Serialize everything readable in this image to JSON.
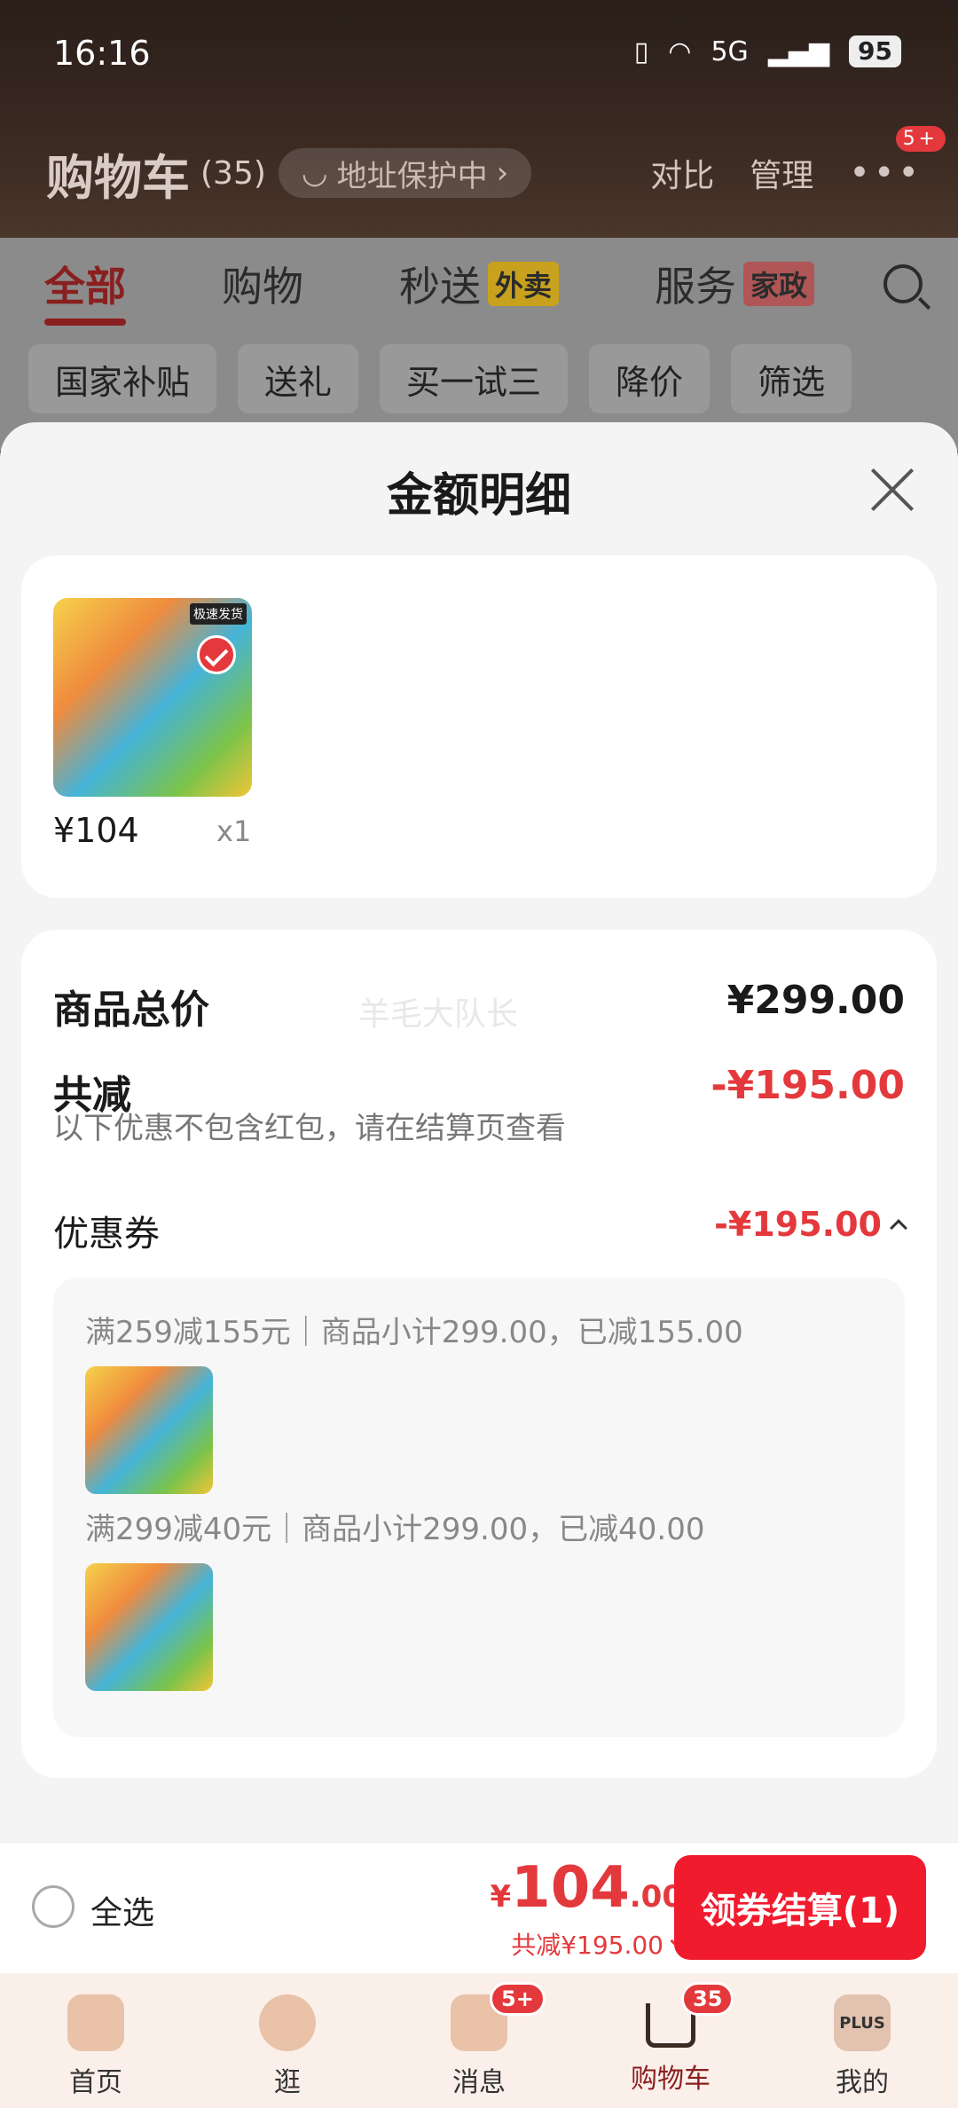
{
  "status_bar": {
    "time": "16:16",
    "network": "5G",
    "battery": "95"
  },
  "header": {
    "title": "购物车",
    "count": "(35)",
    "address": "地址保护中",
    "compare": "对比",
    "manage": "管理",
    "more_badge": "5+"
  },
  "tabs": [
    {
      "label": "全部",
      "tag": ""
    },
    {
      "label": "购物",
      "tag": ""
    },
    {
      "label": "秒送",
      "tag": "外卖"
    },
    {
      "label": "服务",
      "tag": "家政"
    }
  ],
  "chips": [
    "国家补贴",
    "送礼",
    "买一试三",
    "降价",
    "筛选"
  ],
  "sheet": {
    "title": "金额明细",
    "product": {
      "price": "¥104",
      "qty": "x1",
      "image_tag": "极速发货"
    },
    "watermark": "羊毛大队长",
    "total_label": "商品总价",
    "total_value": "¥299.00",
    "reduce_label": "共减",
    "reduce_value": "-¥195.00",
    "note": "以下优惠不包含红包，请在结算页查看",
    "coupon_label": "优惠券",
    "coupon_value": "-¥195.00",
    "rules": [
      "满259减155元｜商品小计299.00，已减155.00",
      "满299减40元｜商品小计299.00，已减40.00"
    ]
  },
  "bar": {
    "select_all": "全选",
    "currency": "¥",
    "amount_int": "104",
    "amount_dec": ".00",
    "reduced": "共减¥195.00",
    "checkout": "领券结算(1)"
  },
  "nav": [
    {
      "label": "首页",
      "badge": ""
    },
    {
      "label": "逛",
      "badge": ""
    },
    {
      "label": "消息",
      "badge": "5+"
    },
    {
      "label": "购物车",
      "badge": "35"
    },
    {
      "label": "我的",
      "badge": "",
      "icon_text": "PLUS"
    }
  ],
  "colors": {
    "accent": "#e4393c",
    "checkout": "#f01b2d",
    "header_dark": "#2a1e19"
  }
}
